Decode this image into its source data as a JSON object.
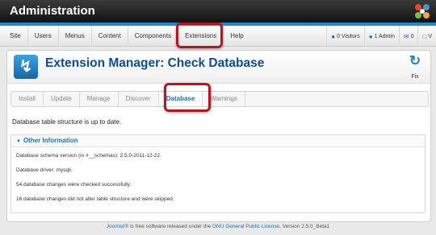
{
  "app": {
    "title": "Administration"
  },
  "menu": {
    "items": [
      "Site",
      "Users",
      "Menus",
      "Content",
      "Components",
      "Extensions",
      "Help"
    ]
  },
  "status": {
    "visitors": "0 Visitors",
    "admins": "1 Admin",
    "messages": "0",
    "view": "V"
  },
  "toolbar": {
    "title": "Extension Manager: Check Database",
    "fix_label": "Fix"
  },
  "tabs": [
    "Install",
    "Update",
    "Manage",
    "Discover",
    "Database",
    "Warnings"
  ],
  "active_tab": "Database",
  "message": "Database table structure is up to date.",
  "other_info": {
    "heading": "Other Information",
    "lines": [
      "Database schema version (in #__schemas): 2.5.0-2011-12-22.",
      "Database driver: mysqli.",
      "54 database changes were checked successfully.",
      "16 database changes did not alter table structure and were skipped."
    ]
  },
  "footer": {
    "joomla": "Joomla!®",
    "text1": " is free software released under the ",
    "license": "GNU General Public License",
    "text2": ".    Version 2.5.0_Beta1"
  },
  "colors": {
    "accent": "#1a8bd2",
    "title_blue": "#0e4d8f",
    "highlight": "#b8161c"
  }
}
